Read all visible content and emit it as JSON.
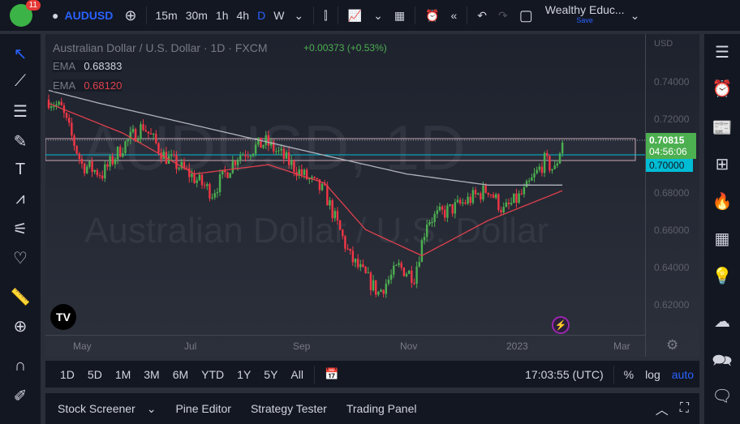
{
  "top": {
    "badge": "11",
    "symbol": "AUDUSD",
    "intervals": [
      "15m",
      "30m",
      "1h",
      "4h",
      "D",
      "W"
    ],
    "active_interval": "D",
    "layout_name": "Wealthy Educ...",
    "save": "Save"
  },
  "legend": {
    "title": "Australian Dollar / U.S. Dollar · 1D · FXCM",
    "change": "+0.00373 (+0.53%)",
    "ema1_label": "EMA",
    "ema1_value": "0.68383",
    "ema2_label": "EMA",
    "ema2_value": "0.68120"
  },
  "watermark": {
    "line1": "AUDUSD, 1D",
    "line2": "Australian Dollar / U.S. Dollar"
  },
  "price_axis": {
    "currency": "USD",
    "ticks": [
      "0.74000",
      "0.72000",
      "0.68000",
      "0.66000",
      "0.64000",
      "0.62000"
    ],
    "last_price": "0.70815",
    "countdown": "04:56:06",
    "level": "0.70000"
  },
  "time_axis": [
    "May",
    "Jul",
    "Sep",
    "Nov",
    "2023",
    "Mar"
  ],
  "ranges": [
    "1D",
    "5D",
    "1M",
    "3M",
    "6M",
    "YTD",
    "1Y",
    "5Y",
    "All"
  ],
  "clock": "17:03:55 (UTC)",
  "scale": {
    "pct": "%",
    "log": "log",
    "auto": "auto"
  },
  "bottom_tabs": [
    "Stock Screener",
    "Pine Editor",
    "Strategy Tester",
    "Trading Panel"
  ],
  "colors": {
    "up": "#4caf50",
    "down": "#f23645",
    "ema_slow": "#b2b5be",
    "ema_fast": "#e0414d",
    "accent": "#2962ff",
    "level": "#00bcd4"
  },
  "chart_data": {
    "type": "candlestick",
    "ylim": [
      0.605,
      0.752
    ],
    "price_path": [
      [
        0,
        0.73
      ],
      [
        5,
        0.725
      ],
      [
        9,
        0.71
      ],
      [
        13,
        0.695
      ],
      [
        21,
        0.69
      ],
      [
        29,
        0.705
      ],
      [
        37,
        0.716
      ],
      [
        45,
        0.7
      ],
      [
        55,
        0.69
      ],
      [
        64,
        0.68
      ],
      [
        74,
        0.7
      ],
      [
        85,
        0.707
      ],
      [
        91,
        0.7
      ],
      [
        99,
        0.69
      ],
      [
        108,
        0.68
      ],
      [
        118,
        0.645
      ],
      [
        129,
        0.626
      ],
      [
        137,
        0.64
      ],
      [
        143,
        0.635
      ],
      [
        148,
        0.665
      ],
      [
        159,
        0.672
      ],
      [
        172,
        0.682
      ],
      [
        178,
        0.67
      ],
      [
        186,
        0.68
      ],
      [
        194,
        0.697
      ],
      [
        198,
        0.692
      ],
      [
        201,
        0.708
      ]
    ],
    "ema_fast": [
      [
        0,
        0.728
      ],
      [
        29,
        0.712
      ],
      [
        57,
        0.69
      ],
      [
        86,
        0.695
      ],
      [
        108,
        0.685
      ],
      [
        124,
        0.66
      ],
      [
        146,
        0.646
      ],
      [
        172,
        0.665
      ],
      [
        201,
        0.681
      ]
    ],
    "ema_slow": [
      [
        0,
        0.735
      ],
      [
        20,
        0.728
      ],
      [
        61,
        0.715
      ],
      [
        108,
        0.7
      ],
      [
        140,
        0.69
      ],
      [
        172,
        0.684
      ],
      [
        201,
        0.684
      ]
    ]
  }
}
